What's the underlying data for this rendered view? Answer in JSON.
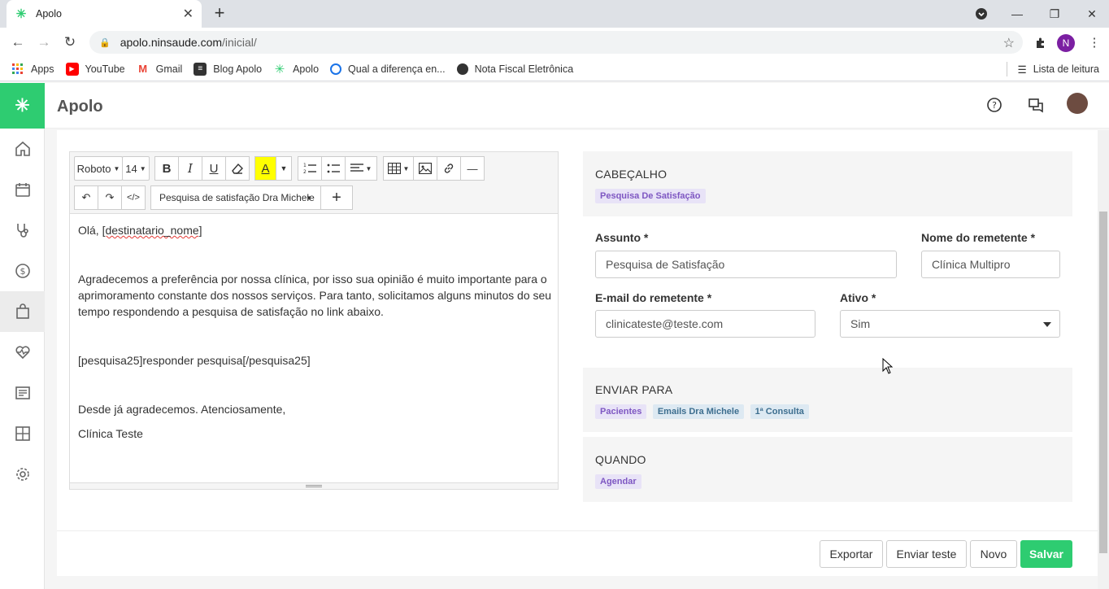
{
  "browser": {
    "tab_title": "Apolo",
    "url_host": "apolo.ninsaude.com",
    "url_path": "/inicial/",
    "profile_initial": "N",
    "bookmarks": [
      "Apps",
      "YouTube",
      "Gmail",
      "Blog Apolo",
      "Apolo",
      "Qual a diferença en...",
      "Nota Fiscal Eletrônica"
    ],
    "reading_list": "Lista de leitura"
  },
  "app": {
    "title": "Apolo",
    "accent": "#2ecc71"
  },
  "editor": {
    "font": "Roboto",
    "size": "14",
    "template_select": "Pesquisa de satisfação Dra Michele",
    "lines": {
      "greeting_prefix": "Olá, ",
      "greeting_var": "[destinatario_nome]",
      "para1": "Agradecemos a preferência por nossa clínica, por isso sua opinião é muito importante para o aprimoramento constante dos nossos serviços. Para tanto, solicitamos alguns minutos do seu tempo respondendo a pesquisa de satisfação no link abaixo.",
      "link": "[pesquisa25]responder pesquisa[/pesquisa25]",
      "closing": "Desde já agradecemos. Atenciosamente,",
      "signature": "Clínica Teste"
    }
  },
  "header_section": {
    "title": "CABEÇALHO",
    "tag": "Pesquisa De Satisfação"
  },
  "form": {
    "subject_label": "Assunto *",
    "subject_value": "Pesquisa de Satisfação",
    "sender_name_label": "Nome do remetente *",
    "sender_name_value": "Clínica Multipro",
    "sender_email_label": "E-mail do remetente *",
    "sender_email_value": "clinicateste@teste.com",
    "active_label": "Ativo *",
    "active_value": "Sim"
  },
  "send_to": {
    "title": "ENVIAR PARA",
    "tags": [
      "Pacientes",
      "Emails Dra Michele",
      "1ª Consulta"
    ]
  },
  "when": {
    "title": "QUANDO",
    "tag": "Agendar"
  },
  "actions": {
    "export": "Exportar",
    "send_test": "Enviar teste",
    "new": "Novo",
    "save": "Salvar"
  }
}
